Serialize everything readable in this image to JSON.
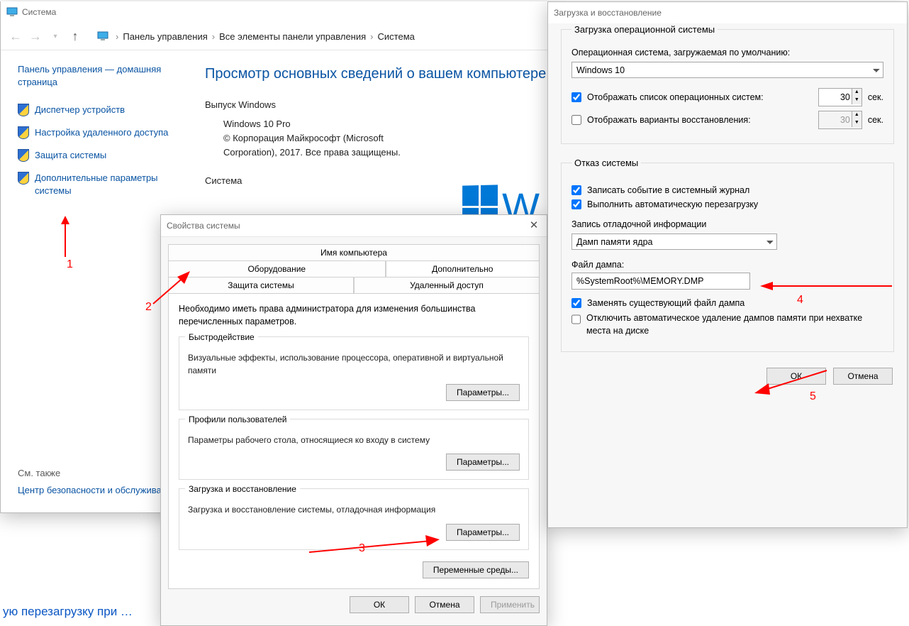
{
  "cp": {
    "title": "Система",
    "breadcrumb": [
      "Панель управления",
      "Все элементы панели управления",
      "Система"
    ],
    "home": "Панель управления — домашняя страница",
    "side": [
      "Диспетчер устройств",
      "Настройка удаленного доступа",
      "Защита системы",
      "Дополнительные параметры системы"
    ],
    "h1": "Просмотр основных сведений о вашем компьютере",
    "edition_h": "Выпуск Windows",
    "edition": "Windows 10 Pro",
    "copyright": "© Корпорация Майкрософт (Microsoft Corporation), 2017. Все права защищены.",
    "system_h": "Система",
    "see_also": "См. также",
    "see_link": "Центр безопасности и обслуживания",
    "taskbar": "ую перезагрузку при …"
  },
  "props": {
    "title": "Свойства системы",
    "tabs_top": [
      "Имя компьютера",
      "Оборудование"
    ],
    "tabs_bot": [
      "Дополнительно",
      "Защита системы",
      "Удаленный доступ"
    ],
    "admin_note": "Необходимо иметь права администратора для изменения большинства перечисленных параметров.",
    "g1_t": "Быстродействие",
    "g1_d": "Визуальные эффекты, использование процессора, оперативной и виртуальной памяти",
    "g2_t": "Профили пользователей",
    "g2_d": "Параметры рабочего стола, относящиеся ко входу в систему",
    "g3_t": "Загрузка и восстановление",
    "g3_d": "Загрузка и восстановление системы, отладочная информация",
    "params": "Параметры...",
    "envvars": "Переменные среды...",
    "ok": "ОК",
    "cancel": "Отмена",
    "apply": "Применить"
  },
  "rec": {
    "title": "Загрузка и восстановление",
    "boot_h": "Загрузка операционной системы",
    "default_os_l": "Операционная система, загружаемая по умолчанию:",
    "default_os": "Windows 10",
    "show_list": "Отображать список операционных систем:",
    "show_list_sec": "30",
    "sec": "сек.",
    "show_recovery": "Отображать варианты восстановления:",
    "show_recovery_sec": "30",
    "fail_h": "Отказ системы",
    "log": "Записать событие в системный журнал",
    "reboot": "Выполнить автоматическую перезагрузку",
    "debug_h": "Запись отладочной информации",
    "dump_type": "Дамп памяти ядра",
    "dump_file_l": "Файл дампа:",
    "dump_file": "%SystemRoot%\\MEMORY.DMP",
    "overwrite": "Заменять существующий файл дампа",
    "nodelete": "Отключить автоматическое удаление дампов памяти при нехватке места на диске",
    "ok": "ОК",
    "cancel": "Отмена"
  },
  "anno": {
    "n1": "1",
    "n2": "2",
    "n3": "3",
    "n4": "4",
    "n5": "5"
  }
}
